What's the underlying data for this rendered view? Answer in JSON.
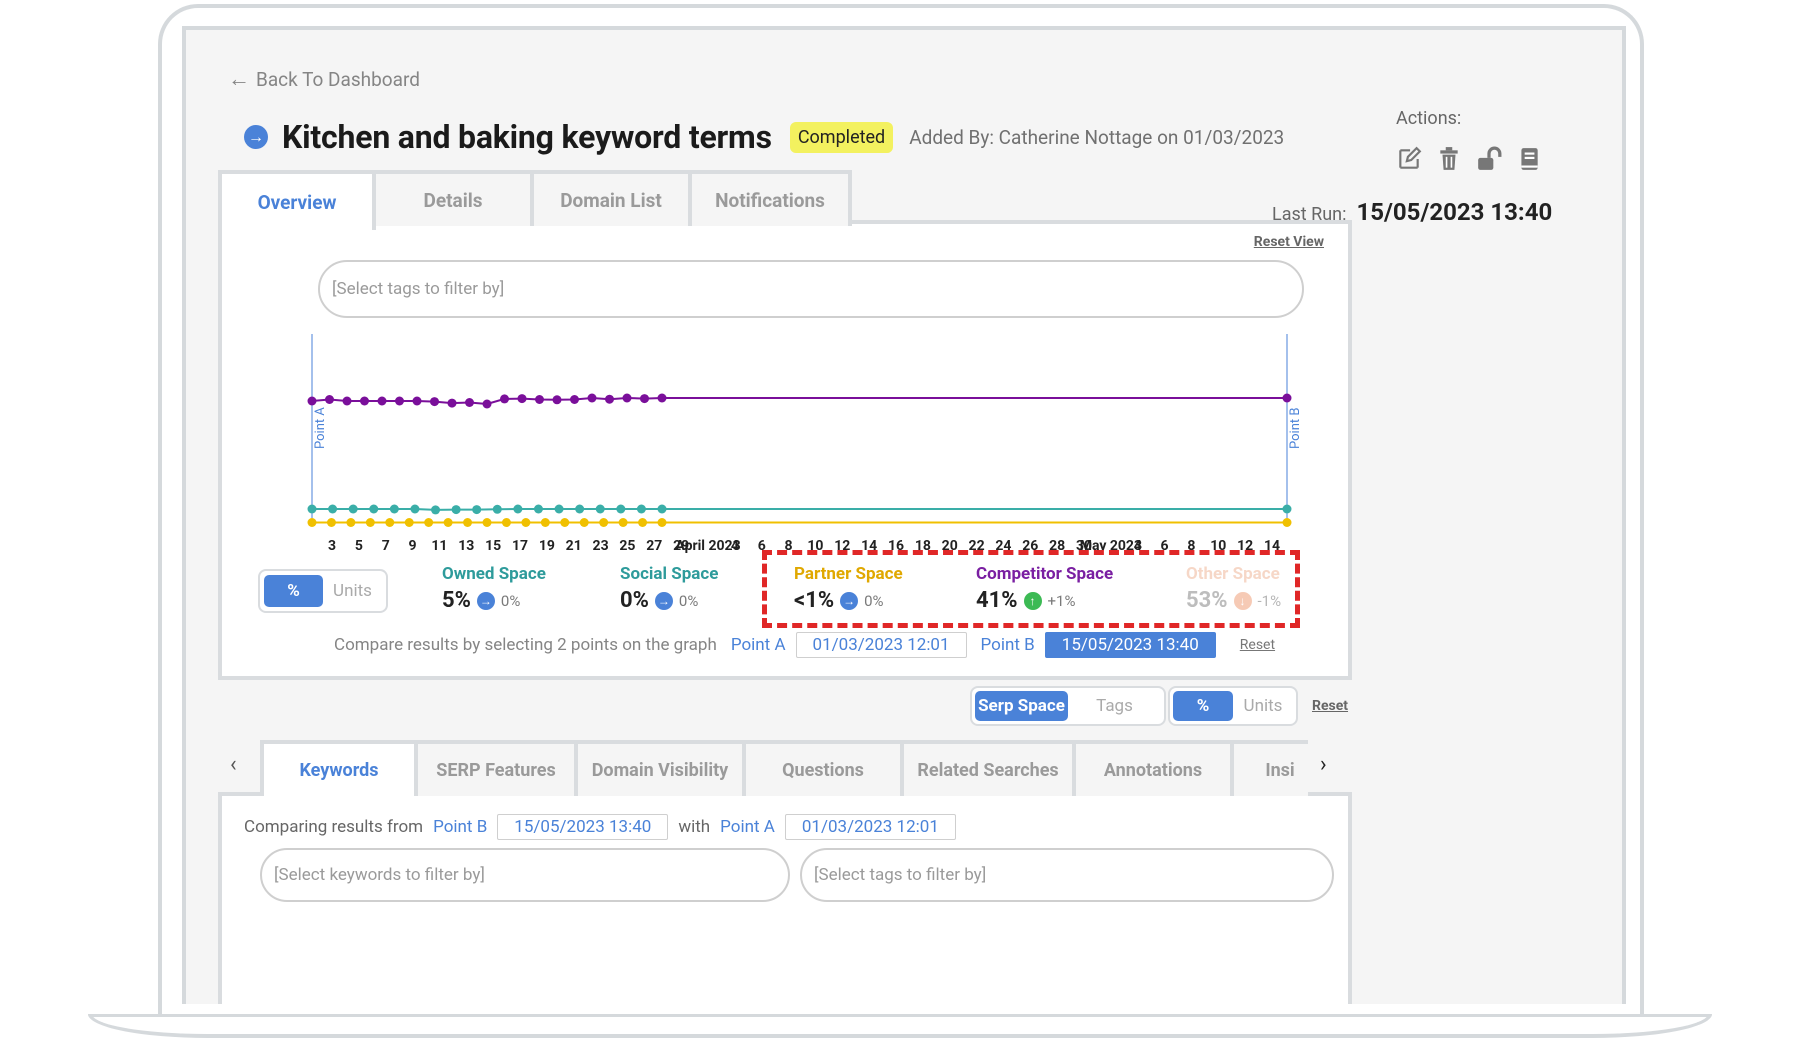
{
  "nav": {
    "back_label": "Back To Dashboard"
  },
  "header": {
    "title": "Kitchen and baking keyword terms",
    "status": "Completed",
    "added_by": "Added By: Catherine Nottage on 01/03/2023",
    "actions_label": "Actions:",
    "action_icons": [
      "edit-icon",
      "trash-icon",
      "unlock-icon",
      "book-icon"
    ],
    "last_run_label": "Last Run:",
    "last_run_value": "15/05/2023 13:40"
  },
  "main_tabs": [
    "Overview",
    "Details",
    "Domain List",
    "Notifications"
  ],
  "overview": {
    "reset_view": "Reset View",
    "tag_filter_placeholder": "[Select tags to filter by]",
    "toggle": {
      "pct": "%",
      "units": "Units"
    },
    "metrics": [
      {
        "label": "Owned Space",
        "value": "5%",
        "change": "0%",
        "trend": "flat",
        "color": "#2e9b9b"
      },
      {
        "label": "Social Space",
        "value": "0%",
        "change": "0%",
        "trend": "flat",
        "color": "#2e9b9b"
      },
      {
        "label": "Partner Space",
        "value": "<1%",
        "change": "0%",
        "trend": "flat",
        "color": "#e0a800"
      },
      {
        "label": "Competitor Space",
        "value": "41%",
        "change": "+1%",
        "trend": "up",
        "color": "#7a1fa2"
      },
      {
        "label": "Other Space",
        "value": "53%",
        "change": "-1%",
        "trend": "down",
        "color": "#f0b89a"
      }
    ],
    "compare_text": "Compare results by selecting 2 points on the graph",
    "point_a_label": "Point A",
    "point_a_value": "01/03/2023 12:01",
    "point_b_label": "Point B",
    "point_b_value": "15/05/2023 13:40",
    "reset_label": "Reset"
  },
  "chart_data": {
    "type": "line",
    "x_tick_labels": [
      "3",
      "5",
      "7",
      "9",
      "11",
      "13",
      "15",
      "17",
      "19",
      "21",
      "23",
      "25",
      "27",
      "29",
      "April 2023",
      "4",
      "6",
      "8",
      "10",
      "12",
      "14",
      "16",
      "18",
      "20",
      "22",
      "24",
      "26",
      "28",
      "30",
      "May 2023",
      "4",
      "6",
      "8",
      "10",
      "12",
      "14"
    ],
    "markers": [
      "Point A",
      "Point B"
    ],
    "series": [
      {
        "name": "Competitor Space",
        "color": "#7a0f9a",
        "values": [
          41,
          41.5,
          41,
          41,
          41,
          41,
          41,
          40.8,
          40.3,
          40.5,
          40,
          41.7,
          41.8,
          41.5,
          41.4,
          41.5,
          42,
          41.6,
          42,
          41.8,
          42,
          42
        ]
      },
      {
        "name": "Owned Space",
        "color": "#3aaea8",
        "values": [
          5,
          5,
          5,
          5,
          5,
          5,
          4.7,
          4.8,
          4.8,
          4.9,
          5,
          5,
          5,
          5,
          5,
          5,
          5,
          5,
          5
        ]
      },
      {
        "name": "Partner Space",
        "color": "#f0c000",
        "values": [
          0.5,
          0.5,
          0.5,
          0.5,
          0.5,
          0.5,
          0.5,
          0.5,
          0.5,
          0.5,
          0.5,
          0.5,
          0.5,
          0.5,
          0.5,
          0.5,
          0.5,
          0.5,
          0.5,
          0.5
        ]
      }
    ]
  },
  "lower_controls": {
    "serp_space": "Serp Space",
    "tags": "Tags",
    "pct": "%",
    "units": "Units",
    "reset": "Reset"
  },
  "bottom_tabs": [
    "Keywords",
    "SERP Features",
    "Domain Visibility",
    "Questions",
    "Related Searches",
    "Annotations",
    "Insi"
  ],
  "comparison": {
    "prefix": "Comparing results from",
    "point_b_label": "Point B",
    "point_b_value": "15/05/2023 13:40",
    "with": "with",
    "point_a_label": "Point A",
    "point_a_value": "01/03/2023 12:01",
    "keyword_filter_placeholder": "[Select keywords to filter by]",
    "tag_filter_placeholder": "[Select tags to filter by]"
  }
}
